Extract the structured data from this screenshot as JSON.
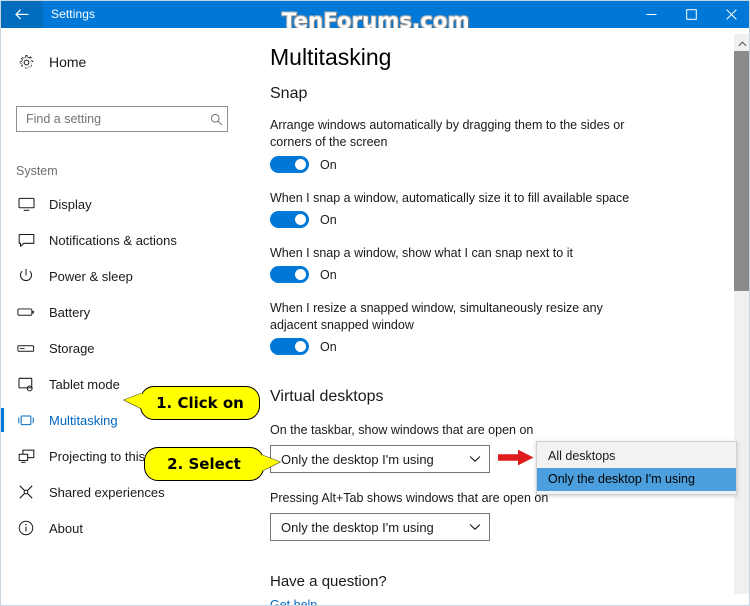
{
  "window": {
    "title": "Settings",
    "watermark": "TenForums.com",
    "back_icon": "back-arrow-icon",
    "minimize_icon": "minimize-icon",
    "maximize_icon": "maximize-icon",
    "close_icon": "close-icon",
    "accent_color": "#0078d7"
  },
  "sidebar": {
    "home_label": "Home",
    "home_icon": "gear-icon",
    "search": {
      "placeholder": "Find a setting",
      "value": "",
      "icon": "search-icon"
    },
    "group_title": "System",
    "items": [
      {
        "label": "Display",
        "icon": "monitor-icon",
        "selected": false
      },
      {
        "label": "Notifications & actions",
        "icon": "notification-icon",
        "selected": false
      },
      {
        "label": "Power & sleep",
        "icon": "power-icon",
        "selected": false
      },
      {
        "label": "Battery",
        "icon": "battery-icon",
        "selected": false
      },
      {
        "label": "Storage",
        "icon": "storage-icon",
        "selected": false
      },
      {
        "label": "Tablet mode",
        "icon": "tablet-icon",
        "selected": false
      },
      {
        "label": "Multitasking",
        "icon": "multitasking-icon",
        "selected": true
      },
      {
        "label": "Projecting to this PC",
        "icon": "projecting-icon",
        "selected": false
      },
      {
        "label": "Shared experiences",
        "icon": "shared-icon",
        "selected": false
      },
      {
        "label": "About",
        "icon": "info-icon",
        "selected": false
      }
    ]
  },
  "main": {
    "page_title": "Multitasking",
    "snap": {
      "heading": "Snap",
      "settings": [
        {
          "description": "Arrange windows automatically by dragging them to the sides or corners of the screen",
          "state": "On"
        },
        {
          "description": "When I snap a window, automatically size it to fill available space",
          "state": "On"
        },
        {
          "description": "When I snap a window, show what I can snap next to it",
          "state": "On"
        },
        {
          "description": "When I resize a snapped window, simultaneously resize any adjacent snapped window",
          "state": "On"
        }
      ]
    },
    "virtual_desktops": {
      "heading": "Virtual desktops",
      "taskbar_label": "On the taskbar, show windows that are open on",
      "taskbar_value": "Only the desktop I'm using",
      "alttab_label": "Pressing Alt+Tab shows windows that are open on",
      "alttab_value": "Only the desktop I'm using",
      "chevron_icon": "chevron-down-icon"
    },
    "footer": {
      "question_heading": "Have a question?",
      "help_link": "Get help"
    }
  },
  "dropdown": {
    "options": [
      {
        "label": "All desktops",
        "selected": false
      },
      {
        "label": "Only the desktop I'm using",
        "selected": true
      }
    ],
    "highlight_color": "#4a9fdc"
  },
  "annotations": {
    "callout_1": "1. Click on",
    "callout_2": "2. Select",
    "arrow_color": "#e01b1b",
    "callout_color": "#ffff00"
  }
}
